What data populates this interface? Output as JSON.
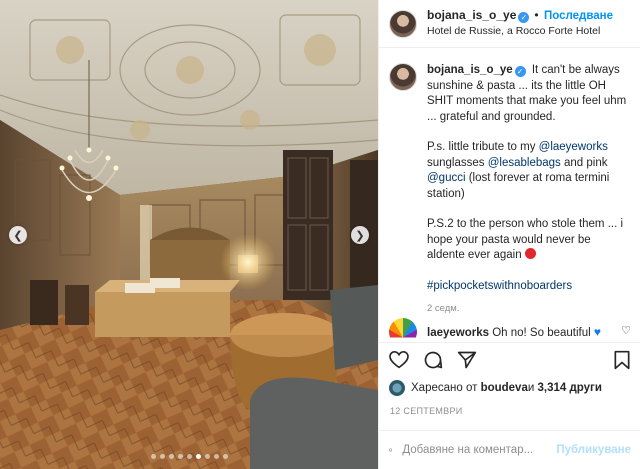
{
  "post": {
    "username": "bojana_is_o_ye",
    "follow_label": "Последване",
    "separator": "•",
    "location": "Hotel de Russie, a Rocco Forte Hotel"
  },
  "caption": {
    "username": "bojana_is_o_ye",
    "line1": "It can't be always sunshine & pasta ... its the little OH SHIT moments that make you feel uhm ... grateful and grounded.",
    "p2_prefix": "P.s. little tribute to my ",
    "mention1": "@laeyeworks",
    "p2_mid1": " sunglasses ",
    "mention2": "@lesablebags",
    "p2_mid2": " and pink ",
    "mention3": "@gucci",
    "p2_suffix": " (lost forever at roma termini station)",
    "p3": "P.S.2 to the person who stole them ... i hope your pasta would never be aldente ever again",
    "hashtag": "#pickpocketswithnoboarders",
    "time_ago": "2 седм."
  },
  "comment": {
    "username": "laeyeworks",
    "text": "Oh no! So beautiful"
  },
  "likes": {
    "prefix": "Харесано от ",
    "user": "boudeva",
    "middle": " и ",
    "count": "3,314 други"
  },
  "date": "12 СЕПТЕМВРИ",
  "add_comment": {
    "placeholder": "Добавяне на коментар...",
    "post_label": "Публикуване"
  },
  "carousel": {
    "dot_count": 9,
    "active_index": 5
  },
  "icons": {
    "verified": "verified-badge-icon",
    "heart": "heart-icon",
    "comment": "comment-icon",
    "share": "share-icon",
    "save": "bookmark-icon",
    "emoji": "smiley-icon"
  },
  "colors": {
    "accent": "#0095f6",
    "mention": "#00376b",
    "muted": "#8e8e8e"
  }
}
